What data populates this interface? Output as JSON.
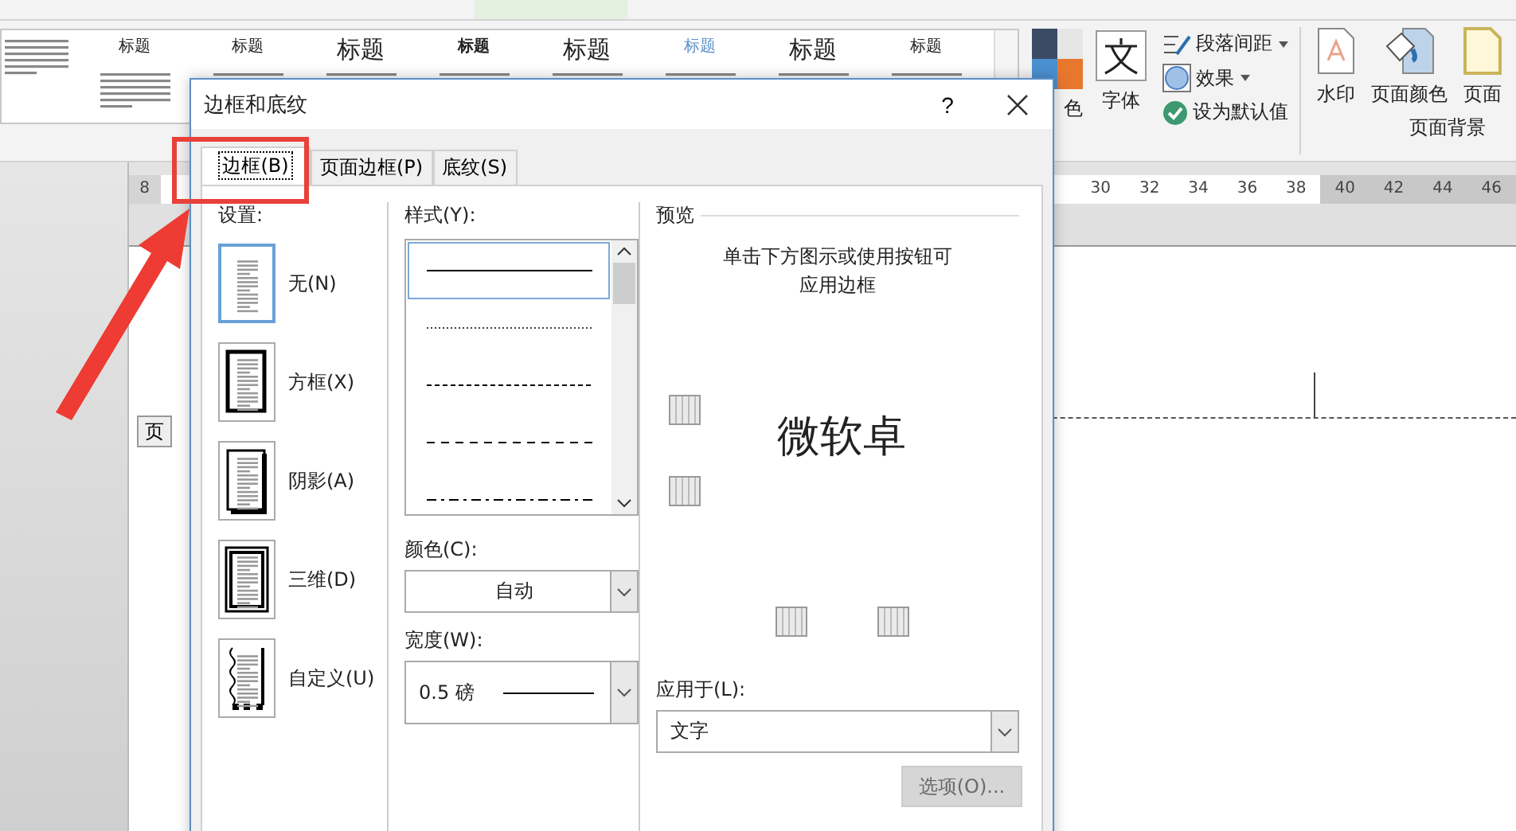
{
  "ribbon": {
    "style_gallery": [
      {
        "heading": "标题",
        "kind": "small"
      },
      {
        "heading": "标题",
        "kind": "small"
      },
      {
        "heading": "标题",
        "kind": "large"
      },
      {
        "heading": "标题",
        "kind": "bold"
      },
      {
        "heading": "标题",
        "kind": "large"
      },
      {
        "heading": "标题",
        "kind": "blue"
      },
      {
        "heading": "标题",
        "kind": "large"
      },
      {
        "heading": "标题",
        "kind": "small"
      }
    ],
    "colors_label": "色",
    "fonts_label": "字体",
    "paragraph_spacing": "段落间距",
    "effects": "效果",
    "set_default": "设为默认值",
    "page_background": {
      "buttons": [
        {
          "label": "水印",
          "kind": "watermark"
        },
        {
          "label": "页面颜色",
          "kind": "page-color"
        },
        {
          "label": "页面",
          "kind": "page-border"
        }
      ],
      "group_label": "页面背景"
    }
  },
  "ruler": {
    "left_numbers": [
      "8"
    ],
    "right_numbers": [
      {
        "text": "30",
        "in_margin": false
      },
      {
        "text": "32",
        "in_margin": false
      },
      {
        "text": "34",
        "in_margin": false
      },
      {
        "text": "36",
        "in_margin": false
      },
      {
        "text": "38",
        "in_margin": false
      },
      {
        "text": "40",
        "in_margin": true
      },
      {
        "text": "42",
        "in_margin": true
      },
      {
        "text": "44",
        "in_margin": true
      },
      {
        "text": "46",
        "in_margin": true
      }
    ]
  },
  "document": {
    "partial_button": "页"
  },
  "dialog": {
    "title": "边框和底纹",
    "help": "?",
    "tabs": [
      {
        "label": "边框(B)",
        "selected": true
      },
      {
        "label": "页面边框(P)",
        "selected": false
      },
      {
        "label": "底纹(S)",
        "selected": false
      }
    ],
    "settings": {
      "label": "设置:",
      "items": [
        {
          "label": "无(N)",
          "kind": "none",
          "selected": true
        },
        {
          "label": "方框(X)",
          "kind": "box",
          "selected": false
        },
        {
          "label": "阴影(A)",
          "kind": "shadow",
          "selected": false
        },
        {
          "label": "三维(D)",
          "kind": "raised",
          "selected": false
        },
        {
          "label": "自定义(U)",
          "kind": "custom",
          "selected": false
        }
      ]
    },
    "style": {
      "label": "样式(Y):",
      "lines": [
        {
          "kind": "solid",
          "selected": true
        },
        {
          "kind": "dotted",
          "selected": false
        },
        {
          "kind": "dashed",
          "selected": false
        },
        {
          "kind": "long-dash",
          "selected": false
        },
        {
          "kind": "dash-dot",
          "selected": false
        }
      ]
    },
    "color": {
      "label": "颜色(C):",
      "value": "自动"
    },
    "width": {
      "label": "宽度(W):",
      "value": "0.5 磅"
    },
    "preview": {
      "label": "预览",
      "hint": "单击下方图示或使用按钮可应用边框",
      "sample": "微软卓"
    },
    "apply_to": {
      "label": "应用于(L):",
      "value": "文字"
    },
    "options_button": {
      "label": "选项(O)...",
      "disabled": true
    }
  }
}
